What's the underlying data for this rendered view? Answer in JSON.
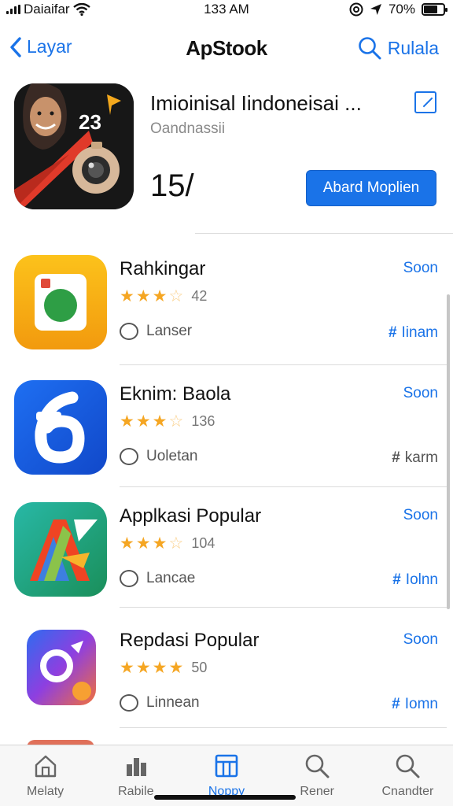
{
  "status_bar": {
    "carrier": "Daiaifar",
    "time": "133 AM",
    "battery": "70%",
    "battery_level": 0.7
  },
  "nav": {
    "back_label": "Layar",
    "title": "ApStook",
    "search_label": "Rulala"
  },
  "featured": {
    "title": "Imioinisal Iindoneisai ...",
    "subtitle": "Oandnassii",
    "rank": "15/",
    "badge_number": "23",
    "button_label": "Abard Moplien"
  },
  "apps": [
    {
      "title": "Rahkingar",
      "stars": 3.5,
      "rating_count": "42",
      "meta": "Lanser",
      "price": "Soon",
      "tag": "Iinam",
      "icon": "camera-app-icon"
    },
    {
      "title": "Eknim: Baola",
      "stars": 3.5,
      "rating_count": "136",
      "meta": "Uoletan",
      "price": "Soon",
      "tag": "karm",
      "icon": "number-six-app-icon"
    },
    {
      "title": "Applkasi Popular",
      "stars": 3.5,
      "rating_count": "104",
      "meta": "Lancae",
      "price": "Soon",
      "tag": "Iolnn",
      "icon": "letter-a-app-icon"
    },
    {
      "title": "Repdasi Popular",
      "stars": 4,
      "rating_count": "50",
      "meta": "Linnean",
      "price": "Soon",
      "tag": "Iomn",
      "icon": "gradient-ring-app-icon"
    }
  ],
  "tabs": [
    {
      "label": "Melaty",
      "icon": "home-icon",
      "active": false
    },
    {
      "label": "Rabile",
      "icon": "chart-icon",
      "active": false
    },
    {
      "label": "Noppy",
      "icon": "grid-icon",
      "active": true
    },
    {
      "label": "Rener",
      "icon": "search-icon",
      "active": false
    },
    {
      "label": "Cnandter",
      "icon": "search-icon",
      "active": false
    }
  ],
  "colors": {
    "accent": "#1a73e8",
    "star": "#f5a623"
  }
}
